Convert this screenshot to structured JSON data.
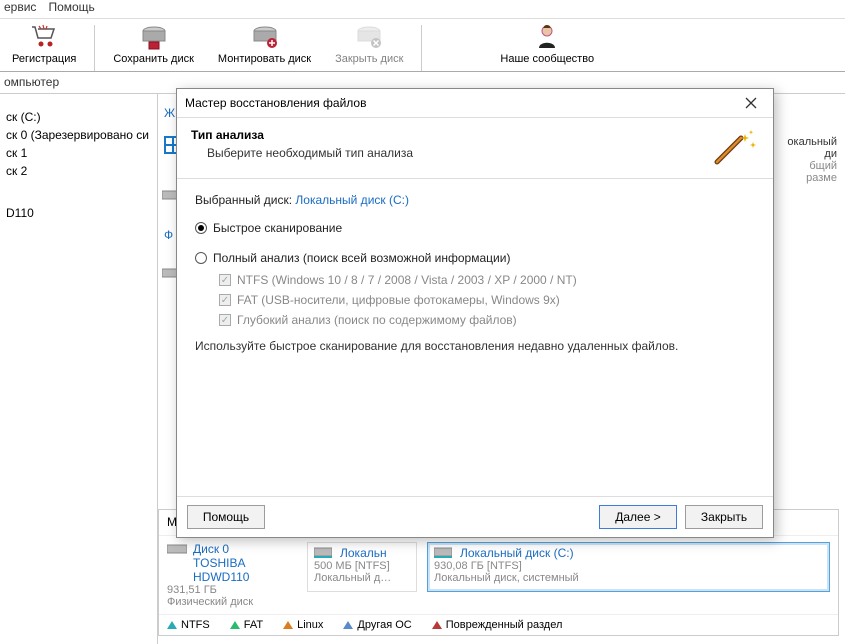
{
  "menu": {
    "service": "ервис",
    "help": "Помощь"
  },
  "toolbar": {
    "register": "Регистрация",
    "save": "Сохранить диск",
    "mount": "Монтировать диск",
    "close": "Закрыть диск",
    "community": "Наше сообщество"
  },
  "address": "омпьютер",
  "sidebar": {
    "items": [
      "ск (C:)",
      "ск 0 (Зарезервировано си",
      "ск 1",
      "ск 2",
      "",
      "D110"
    ],
    "drive_letter": "Ж",
    "file_letter": "Ф"
  },
  "right_fragment": {
    "line1": "окальный ди",
    "line2": "бщий разме"
  },
  "dialog": {
    "title": "Мастер восстановления файлов",
    "header_title": "Тип анализа",
    "header_sub": "Выберите необходимый тип анализа",
    "selected_disk_label": "Выбранный диск:",
    "selected_disk_value": "Локальный диск (C:)",
    "radio_fast": "Быстрое сканирование",
    "radio_full": "Полный анализ (поиск всей возможной информации)",
    "chk_ntfs": "NTFS (Windows 10 / 8 / 7 / 2008 / Vista / 2003 / XP / 2000 / NT)",
    "chk_fat": "FAT (USB-носители, цифровые фотокамеры, Windows 9x)",
    "chk_deep": "Глубокий анализ (поиск по содержимому файлов)",
    "hint": "Используйте быстрое сканирование для восстановления недавно удаленных файлов.",
    "btn_help": "Помощь",
    "btn_next": "Далее >",
    "btn_close": "Закрыть"
  },
  "bottom": {
    "menu": "Мен",
    "disk0": {
      "name": "Диск 0",
      "model": "TOSHIBA HDWD110",
      "size": "931,51 ГБ",
      "type": "Физический диск"
    },
    "p1": {
      "name": "Локальн",
      "size": "500 МБ [NTFS]",
      "desc": "Локальный д…"
    },
    "p2": {
      "name": "Локальный диск (C:)",
      "size": "930,08 ГБ [NTFS]",
      "desc": "Локальный диск, системный"
    },
    "legend": {
      "ntfs": "NTFS",
      "fat": "FAT",
      "linux": "Linux",
      "other": "Другая ОС",
      "dmg": "Поврежденный раздел"
    }
  }
}
